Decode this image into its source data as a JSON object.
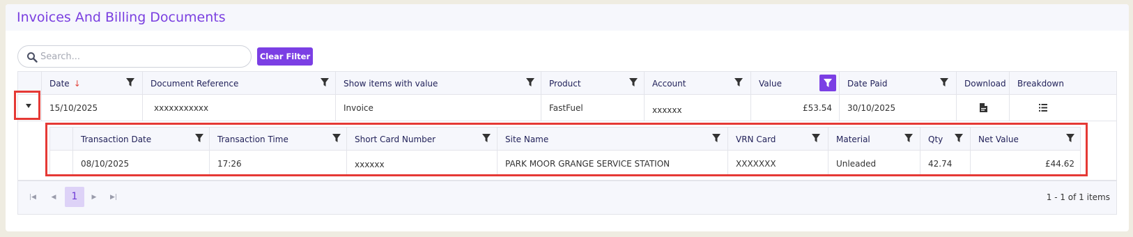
{
  "page": {
    "title": "Invoices And Billing Documents"
  },
  "search": {
    "placeholder": "Search..."
  },
  "toolbar": {
    "clear_filter_label": "Clear Filter"
  },
  "grid": {
    "columns": [
      {
        "key": "date",
        "label": "Date",
        "sorted": "descending",
        "filter_active": false
      },
      {
        "key": "document_reference",
        "label": "Document Reference",
        "filter_active": false
      },
      {
        "key": "show_items_with_value",
        "label": "Show items with value",
        "filter_active": false
      },
      {
        "key": "product",
        "label": "Product",
        "filter_active": false
      },
      {
        "key": "account",
        "label": "Account",
        "filter_active": false
      },
      {
        "key": "value",
        "label": "Value",
        "filter_active": true
      },
      {
        "key": "date_paid",
        "label": "Date Paid",
        "filter_active": false
      },
      {
        "key": "download",
        "label": "Download"
      },
      {
        "key": "breakdown",
        "label": "Breakdown"
      }
    ],
    "rows": [
      {
        "date": "15/10/2025",
        "document_reference": "xxxxxxxxxxx",
        "show_items_with_value": "Invoice",
        "product": "FastFuel",
        "account": "xxxxxx",
        "value": "£53.54",
        "date_paid": "30/10/2025",
        "download_icon": "pdf-file-icon",
        "breakdown_icon": "list-icon"
      }
    ]
  },
  "detail": {
    "columns": [
      {
        "key": "transaction_date",
        "label": "Transaction Date"
      },
      {
        "key": "transaction_time",
        "label": "Transaction Time"
      },
      {
        "key": "short_card_number",
        "label": "Short Card Number"
      },
      {
        "key": "site_name",
        "label": "Site Name"
      },
      {
        "key": "vrn_card",
        "label": "VRN Card"
      },
      {
        "key": "material",
        "label": "Material"
      },
      {
        "key": "qty",
        "label": "Qty"
      },
      {
        "key": "net_value",
        "label": "Net Value"
      }
    ],
    "rows": [
      {
        "transaction_date": "08/10/2025",
        "transaction_time": "17:26",
        "short_card_number": "xxxxxx",
        "site_name": "PARK MOOR GRANGE SERVICE STATION",
        "vrn_card": "XXXXXXX",
        "material": "Unleaded",
        "qty": "42.74",
        "net_value": "£44.62"
      }
    ]
  },
  "pager": {
    "current_page": "1",
    "info": "1 - 1 of 1 items"
  },
  "colors": {
    "accent": "#7b3fe4",
    "title": "#7a3fe0",
    "highlight_outline": "#e53935",
    "sort_arrow": "#e2453c"
  }
}
